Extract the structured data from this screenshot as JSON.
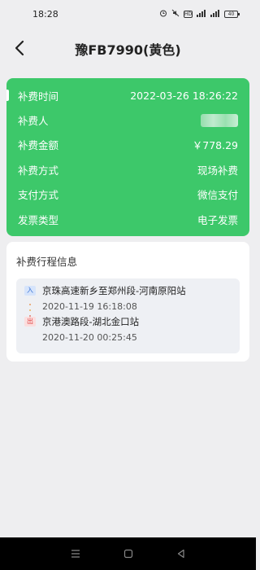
{
  "status_bar": {
    "time": "18:28",
    "icons": [
      "alarm-icon",
      "mute-icon",
      "hd-icon",
      "signal-icon",
      "signal-icon",
      "battery-icon"
    ],
    "battery_label": "40"
  },
  "header": {
    "title": "豫FB7990(黄色)",
    "back_icon": "chevron-left-icon"
  },
  "payment": {
    "rows": [
      {
        "label": "补费时间",
        "value": "2022-03-26 18:26:22"
      },
      {
        "label": "补费人",
        "value": ""
      },
      {
        "label": "补费金额",
        "value": "￥778.29"
      },
      {
        "label": "补费方式",
        "value": "现场补费"
      },
      {
        "label": "支付方式",
        "value": "微信支付"
      },
      {
        "label": "发票类型",
        "value": "电子发票"
      }
    ],
    "card_color": "#3dc86a"
  },
  "trip": {
    "title": "补费行程信息",
    "entry": {
      "badge": "入",
      "station": "京珠高速新乡至郑州段-河南原阳站",
      "time": "2020-11-19 16:18:08"
    },
    "exit": {
      "badge": "出",
      "station": "京港澳路段-湖北金口站",
      "time": "2020-11-20 00:25:45"
    }
  },
  "nav_bar": {
    "icons": [
      "menu-icon",
      "home-square-icon",
      "back-triangle-icon"
    ]
  }
}
